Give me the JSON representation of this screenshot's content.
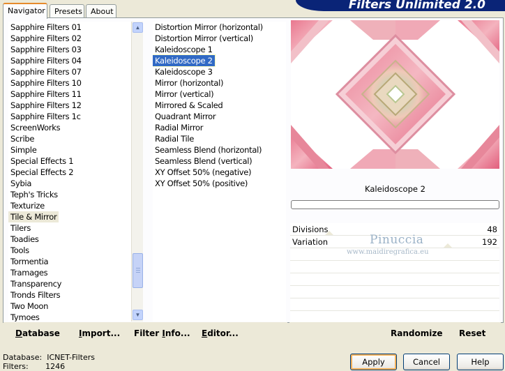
{
  "tabs": [
    "Navigator",
    "Presets",
    "About"
  ],
  "brand": "Filters Unlimited 2.0",
  "categories": [
    "Sapphire Filters 01",
    "Sapphire Filters 02",
    "Sapphire Filters 03",
    "Sapphire Filters 04",
    "Sapphire Filters 07",
    "Sapphire Filters 10",
    "Sapphire Filters 11",
    "Sapphire Filters 12",
    "Sapphire Filters 1c",
    "ScreenWorks",
    "Scribe",
    "Simple",
    "Special Effects 1",
    "Special Effects 2",
    "Sybia",
    "Teph's Tricks",
    "Texturize",
    "Tile & Mirror",
    "Tilers",
    "Toadies",
    "Tools",
    "Tormentia",
    "Tramages",
    "Transparency",
    "Tronds Filters",
    "Two Moon",
    "Tymoes"
  ],
  "selected_category": "Tile & Mirror",
  "filters": [
    "Distortion Mirror (horizontal)",
    "Distortion Mirror (vertical)",
    "Kaleidoscope 1",
    "Kaleidoscope 2",
    "Kaleidoscope 3",
    "Mirror (horizontal)",
    "Mirror (vertical)",
    "Mirrored & Scaled",
    "Quadrant Mirror",
    "Radial Mirror",
    "Radial Tile",
    "Seamless Blend (horizontal)",
    "Seamless Blend (vertical)",
    "XY Offset 50% (negative)",
    "XY Offset 50% (positive)"
  ],
  "selected_filter": "Kaleidoscope 2",
  "preview_caption": "Kaleidoscope 2",
  "params": [
    {
      "label": "Divisions",
      "value": "48"
    },
    {
      "label": "Variation",
      "value": "192"
    }
  ],
  "watermark": {
    "name": "Pinuccia",
    "url": "www.maidiregrafica.eu"
  },
  "toolbar_left": [
    {
      "hot": "D",
      "rest": "atabase"
    },
    {
      "hot": "I",
      "rest": "mport..."
    },
    {
      "pre": "Filter ",
      "hot": "I",
      "rest": "nfo..."
    },
    {
      "hot": "E",
      "rest": "ditor..."
    }
  ],
  "toolbar_right": [
    "Randomize",
    "Reset"
  ],
  "status": {
    "db_label": "Database:",
    "db_value": "ICNET-Filters",
    "f_label": "Filters:",
    "f_value": "1246"
  },
  "buttons": {
    "apply": "Apply",
    "cancel": "Cancel",
    "help": "Help"
  }
}
